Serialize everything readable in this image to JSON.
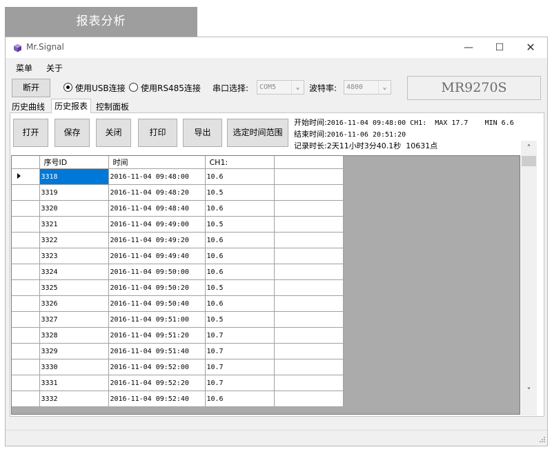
{
  "banner": "报表分析",
  "window": {
    "title": "Mr.Signal",
    "controls": {
      "minimize": "—",
      "maximize": "☐",
      "close": "✕"
    }
  },
  "menu": {
    "items": [
      "菜单",
      "关于"
    ]
  },
  "connection": {
    "disconnect_label": "断开",
    "usb_label": "使用USB连接",
    "rs485_label": "使用RS485连接",
    "selected": "usb",
    "port_label": "串口选择:",
    "port_value": "COM5",
    "baud_label": "波特率:",
    "baud_value": "4800",
    "device_model": "MR9270S"
  },
  "tabs": [
    "历史曲线",
    "历史报表",
    "控制面板"
  ],
  "active_tab": "历史报表",
  "actions": [
    "打开",
    "保存",
    "关闭",
    "打印",
    "导出",
    "选定时间范围"
  ],
  "info": {
    "start_label": "开始时间:",
    "start_value": "2016-11-04 09:48:00",
    "ch_label": "CH1:",
    "max_label": "MAX",
    "max_value": "17.7",
    "min_label": "MIN",
    "min_value": "6.6",
    "end_label": "结束时间:",
    "end_value": "2016-11-06 20:51:20",
    "duration_label": "记录时长:",
    "duration_value": "2天11小时3分40.1秒",
    "points_value": "10631点"
  },
  "table": {
    "columns": [
      "序号ID",
      "时间",
      "CH1:",
      ""
    ],
    "rows": [
      [
        "3318",
        "2016-11-04 09:48:00",
        "10.6"
      ],
      [
        "3319",
        "2016-11-04 09:48:20",
        "10.5"
      ],
      [
        "3320",
        "2016-11-04 09:48:40",
        "10.6"
      ],
      [
        "3321",
        "2016-11-04 09:49:00",
        "10.5"
      ],
      [
        "3322",
        "2016-11-04 09:49:20",
        "10.6"
      ],
      [
        "3323",
        "2016-11-04 09:49:40",
        "10.6"
      ],
      [
        "3324",
        "2016-11-04 09:50:00",
        "10.6"
      ],
      [
        "3325",
        "2016-11-04 09:50:20",
        "10.5"
      ],
      [
        "3326",
        "2016-11-04 09:50:40",
        "10.6"
      ],
      [
        "3327",
        "2016-11-04 09:51:00",
        "10.5"
      ],
      [
        "3328",
        "2016-11-04 09:51:20",
        "10.7"
      ],
      [
        "3329",
        "2016-11-04 09:51:40",
        "10.7"
      ],
      [
        "3330",
        "2016-11-04 09:52:00",
        "10.7"
      ],
      [
        "3331",
        "2016-11-04 09:52:20",
        "10.7"
      ],
      [
        "3332",
        "2016-11-04 09:52:40",
        "10.6"
      ]
    ],
    "selected_row": 0
  },
  "scroll": {
    "up": "˄",
    "down": "˅"
  },
  "colors": {
    "selection": "#0078d7",
    "grid_bg": "#ababab",
    "banner_bg": "#9e9e9e"
  }
}
